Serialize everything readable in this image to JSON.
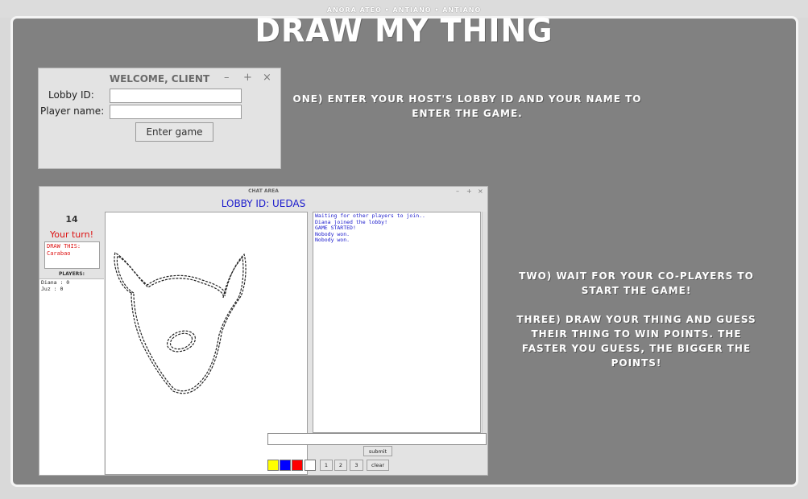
{
  "window_caption": "ANORA ATEO • ANTIANO • ANTIANO",
  "app_title": "DRAW MY THING",
  "instructions": {
    "step_one": "ONE) ENTER YOUR HOST'S LOBBY ID AND YOUR NAME TO ENTER THE GAME.",
    "step_two": "TWO) WAIT FOR YOUR CO-PLAYERS TO START THE GAME!",
    "step_three": "THREE) DRAW YOUR THING AND GUESS THEIR THING TO WIN POINTS. THE FASTER YOU GUESS, THE BIGGER THE POINTS!"
  },
  "welcome_window": {
    "title": "WELCOME, CLIENT",
    "lobby_label": "Lobby ID:",
    "lobby_value": "",
    "name_label": "Player name:",
    "name_value": "",
    "enter_button": "Enter game",
    "controls": {
      "minimize": "–",
      "maximize": "+",
      "close": "×"
    }
  },
  "chat_window": {
    "title": "CHAT AREA",
    "lobby_id_text": "LOBBY ID: UEDAS",
    "timer": "14",
    "turn_text": "Your turn!",
    "draw_this_label": "DRAW THIS:",
    "draw_this_word": "Carabao",
    "players_header": "PLAYERS:",
    "players": [
      "Diana : 0",
      "Juz : 0"
    ],
    "messages": [
      "Waiting for other players to join..",
      "Diana joined the lobby!",
      "GAME STARTED!",
      "Nobody won.",
      "Nobody won."
    ],
    "chat_input_value": "",
    "submit_label": "submit",
    "colors": [
      "#ffff00",
      "#0000ff",
      "#ff0000",
      "#ffffff"
    ],
    "brush_sizes": [
      "1",
      "2",
      "3"
    ],
    "clear_label": "clear",
    "controls": {
      "minimize": "–",
      "maximize": "+",
      "close": "×"
    }
  }
}
